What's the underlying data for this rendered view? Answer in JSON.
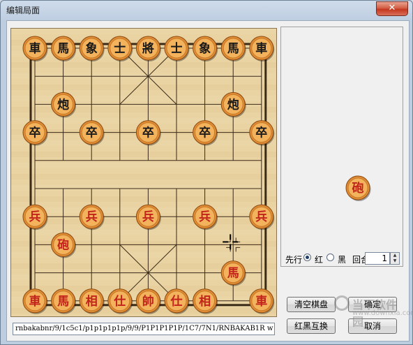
{
  "window": {
    "title": "编辑局面",
    "close_label": "✕"
  },
  "board": {
    "top_row": [
      {
        "t": "車",
        "c": "black"
      },
      {
        "t": "馬",
        "c": "black"
      },
      {
        "t": "象",
        "c": "black"
      },
      {
        "t": "士",
        "c": "black"
      },
      {
        "t": "將",
        "c": "black"
      },
      {
        "t": "士",
        "c": "black"
      },
      {
        "t": "象",
        "c": "black"
      },
      {
        "t": "馬",
        "c": "black"
      },
      {
        "t": "車",
        "c": "black"
      }
    ],
    "pieces": [
      {
        "t": "炮",
        "c": "black",
        "col": 1,
        "row": 2
      },
      {
        "t": "炮",
        "c": "black",
        "col": 7,
        "row": 2
      },
      {
        "t": "卒",
        "c": "black",
        "col": 0,
        "row": 3
      },
      {
        "t": "卒",
        "c": "black",
        "col": 2,
        "row": 3
      },
      {
        "t": "卒",
        "c": "black",
        "col": 4,
        "row": 3
      },
      {
        "t": "卒",
        "c": "black",
        "col": 6,
        "row": 3
      },
      {
        "t": "卒",
        "c": "black",
        "col": 8,
        "row": 3
      },
      {
        "t": "兵",
        "c": "red",
        "col": 0,
        "row": 6
      },
      {
        "t": "兵",
        "c": "red",
        "col": 2,
        "row": 6
      },
      {
        "t": "兵",
        "c": "red",
        "col": 4,
        "row": 6
      },
      {
        "t": "兵",
        "c": "red",
        "col": 6,
        "row": 6
      },
      {
        "t": "兵",
        "c": "red",
        "col": 8,
        "row": 6
      },
      {
        "t": "砲",
        "c": "red",
        "col": 1,
        "row": 7
      },
      {
        "t": "馬",
        "c": "red",
        "col": 7,
        "row": 8
      }
    ],
    "bottom_row": [
      {
        "t": "車",
        "c": "red"
      },
      {
        "t": "馬",
        "c": "red"
      },
      {
        "t": "相",
        "c": "red"
      },
      {
        "t": "仕",
        "c": "red"
      },
      {
        "t": "帥",
        "c": "red"
      },
      {
        "t": "仕",
        "c": "red"
      },
      {
        "t": "相",
        "c": "red"
      },
      {
        "t": "",
        "c": "none"
      },
      {
        "t": "車",
        "c": "red"
      }
    ]
  },
  "fen": {
    "value": "rnbakabnr/9/1c5c1/p1p1p1p1p/9/9/P1P1P1P1P/1C7/7N1/RNBAKAB1R w"
  },
  "side_panel": {
    "piece": {
      "t": "砲",
      "c": "red"
    }
  },
  "controls": {
    "first_move_label": "先行",
    "red_label": "红",
    "black_label": "黑",
    "red_selected": true,
    "round_label": "回合",
    "round_value": "1"
  },
  "buttons": {
    "clear": "清空棋盘",
    "ok": "确定",
    "swap": "红黑互换",
    "cancel": "取消"
  },
  "watermark": {
    "text": "当下软件园",
    "sub": "www.downxia.com"
  },
  "colors": {
    "board": "#e9d3a3",
    "piece_face": "#f0a64c",
    "red_text": "#c2231b",
    "black_text": "#1a1a1a"
  }
}
